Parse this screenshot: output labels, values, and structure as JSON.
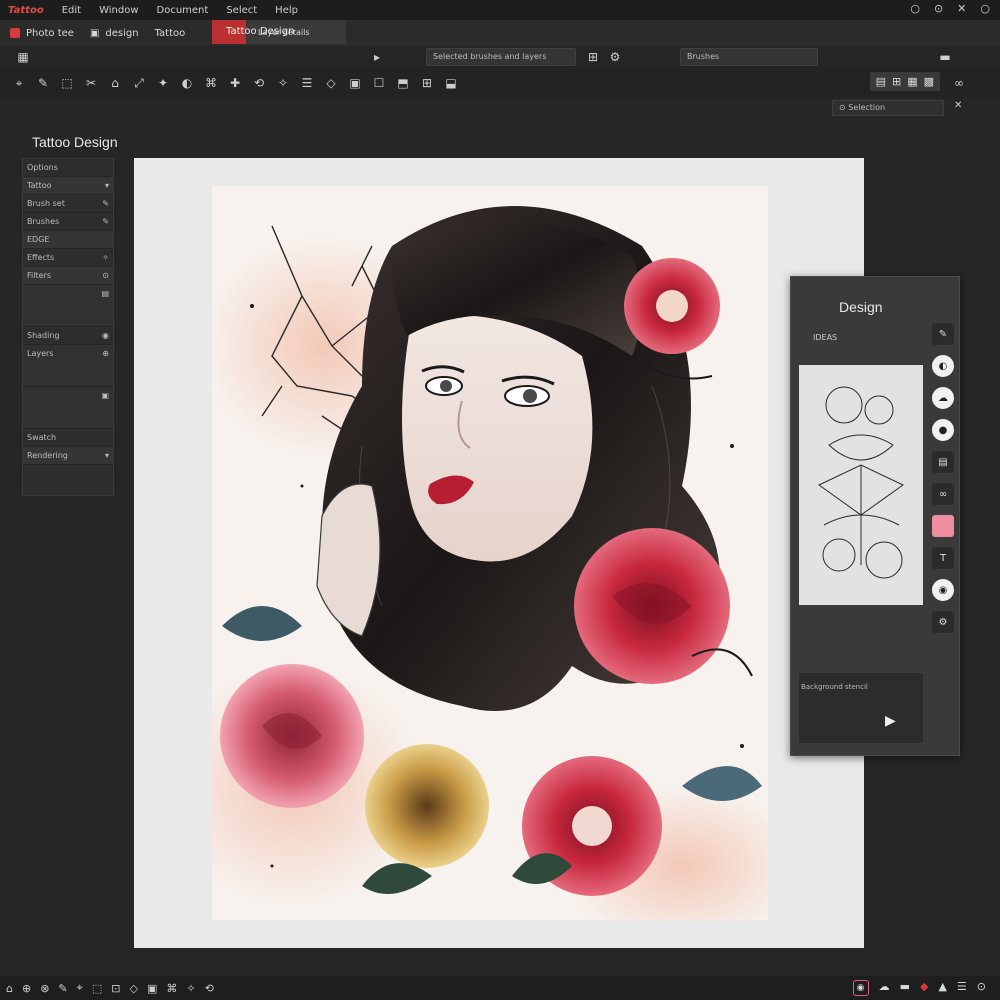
{
  "menubar": {
    "items": [
      "Tattoo",
      "Edit",
      "Window",
      "Document",
      "Select",
      "Help"
    ],
    "window_controls": [
      "○",
      "⊙",
      "✕",
      "○"
    ]
  },
  "tabs": {
    "file_tab": "Photo tee",
    "design_tab": "design",
    "second_tab": "Tattoo",
    "active_doc": "Tattoo Design",
    "active_doc_sub": "Layer details"
  },
  "options": {
    "field_a": "Selected brushes and layers",
    "field_b": "Brushes"
  },
  "toolbar": {
    "tools": [
      "⌖",
      "✎",
      "⬚",
      "✂",
      "⌂",
      "⤢",
      "✦",
      "◐",
      "⌘",
      "✚",
      "⟲",
      "✧",
      "☰",
      "◇",
      "▣",
      "☐",
      "⬒",
      "⊞",
      "⬓"
    ],
    "right_group": [
      "▤",
      "⊞",
      "▦",
      "▩"
    ]
  },
  "zoom": {
    "label": "Selection",
    "close": "✕"
  },
  "document": {
    "title": "Tattoo Design"
  },
  "left_panel": {
    "rows": [
      {
        "label": "Options",
        "value": ""
      },
      {
        "label": "Tattoo",
        "value": ""
      },
      {
        "label": "Brush set",
        "value": ""
      },
      {
        "label": "Brushes",
        "value": ""
      },
      {
        "label": "EDGE",
        "value": ""
      },
      {
        "label": "Effects",
        "value": ""
      },
      {
        "label": "Filters",
        "value": ""
      },
      {
        "label": "",
        "value": ""
      },
      {
        "label": "Shading",
        "value": ""
      },
      {
        "label": "Layers",
        "value": ""
      },
      {
        "label": "",
        "value": ""
      },
      {
        "label": "Swatch",
        "value": ""
      },
      {
        "label": "Rendering",
        "value": ""
      }
    ]
  },
  "right_panel": {
    "title": "Design",
    "label": "IDEAS",
    "caption": "Background stencil",
    "play": "▶",
    "swatch_color": "#f08ca0"
  },
  "statusbar": {
    "left_icons": [
      "⌂",
      "⊕",
      "⊗",
      "✎",
      "⌖",
      "⬚",
      "⊡",
      "◇",
      "▣",
      "⌘",
      "✧",
      "⟲"
    ],
    "right_icons": [
      "◉",
      "☁",
      "▬",
      "◆",
      "▲",
      "☰",
      "⊙"
    ]
  },
  "colors": {
    "accent_red": "#d83a3a",
    "rose_red": "#c8283e",
    "ink": "#1a1a1a"
  }
}
